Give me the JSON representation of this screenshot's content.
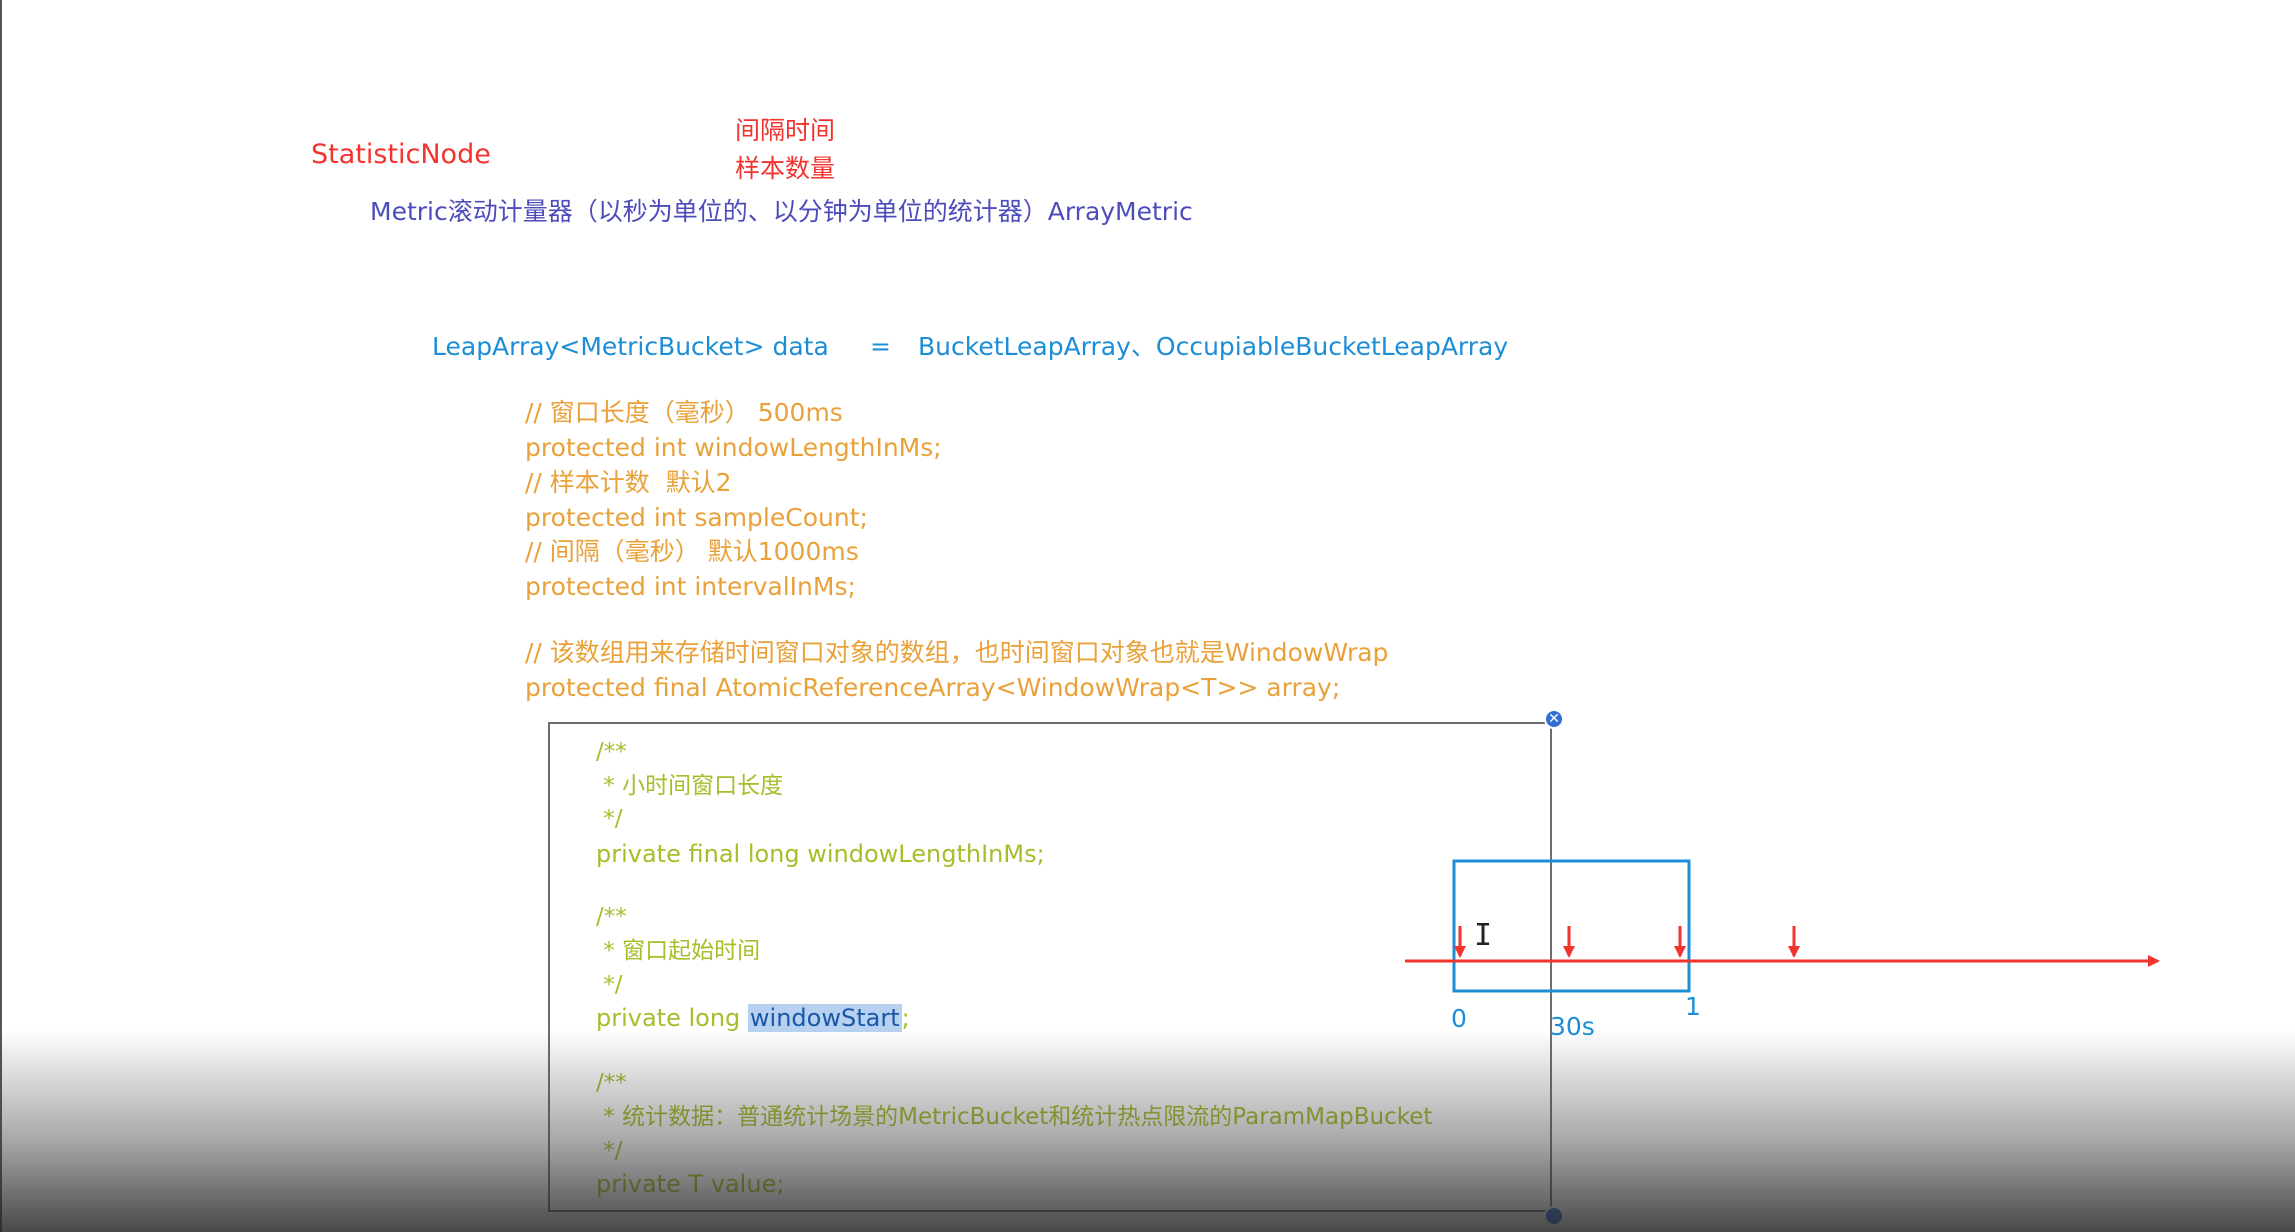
{
  "header": {
    "node_label": "StatisticNode",
    "note_line1": "间隔时间",
    "note_line2": "样本数量",
    "metric_line": "Metric滚动计量器（以秒为单位的、以分钟为单位的统计器）ArrayMetric"
  },
  "leap": {
    "decl": "LeapArray<MetricBucket> data",
    "eq": "=",
    "impls": "BucketLeapArray、OccupiableBucketLeapArray"
  },
  "fields": [
    "// 窗口长度（毫秒） 500ms",
    "protected int windowLengthInMs;",
    "// 样本计数  默认2",
    "protected int sampleCount;",
    "// 间隔（毫秒） 默认1000ms",
    "protected int intervalInMs;",
    "// 该数组用来存储时间窗口对象的数组，也时间窗口对象也就是WindowWrap",
    "protected final AtomicReferenceArray<WindowWrap<T>> array;"
  ],
  "code": {
    "c1a": "/**",
    "c1b": " * 小时间窗口长度",
    "c1c": " */",
    "f1": "private final long windowLengthInMs;",
    "c2a": "/**",
    "c2b": " * 窗口起始时间",
    "c2c": " */",
    "f2_prefix": "private long ",
    "f2_sel": "windowStart",
    "f2_suffix": ";",
    "c3a": "/**",
    "c3b": " * 统计数据：普通统计场景的MetricBucket和统计热点限流的ParamMapBucket",
    "c3c": " */",
    "f3": "private T value;"
  },
  "timeline": {
    "label_start": "0",
    "label_mid": "30s",
    "label_end": "1",
    "arrow_color": "#f2332e",
    "box_color": "#1c8ed8"
  },
  "colors": {
    "red": "#f2332e",
    "purple": "#4c4dbb",
    "blue": "#1c8ed8",
    "orange": "#e9a13a",
    "green": "#a8bd2a"
  }
}
